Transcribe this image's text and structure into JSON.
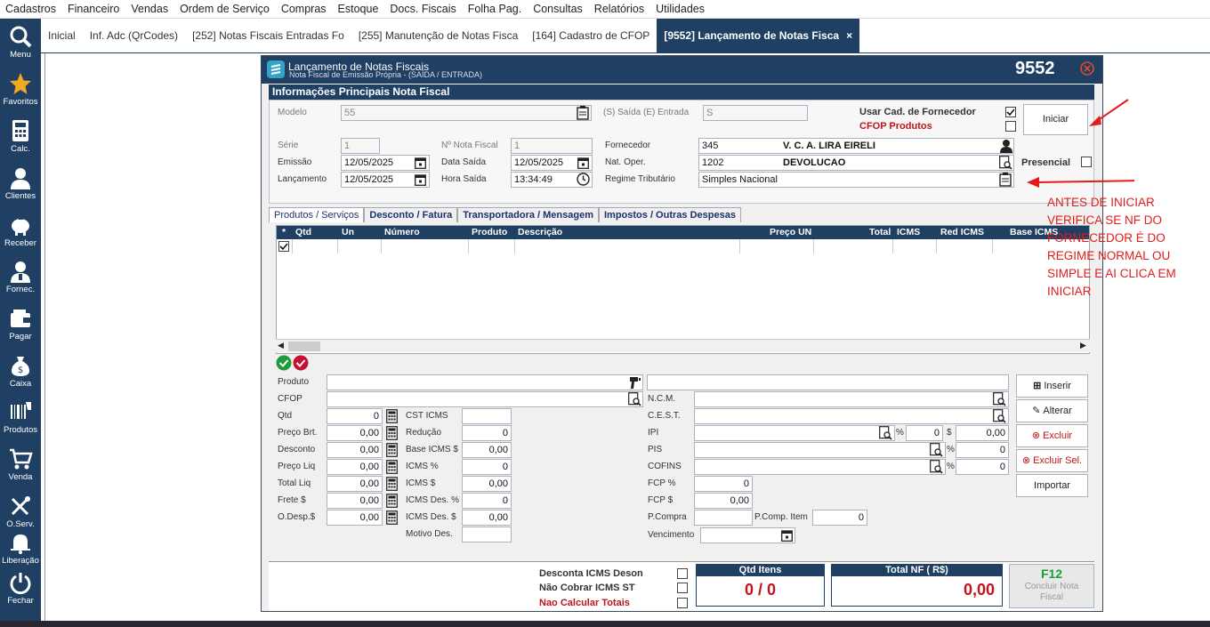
{
  "menubar": [
    "Cadastros",
    "Financeiro",
    "Vendas",
    "Ordem de Serviço",
    "Compras",
    "Estoque",
    "Docs. Fiscais",
    "Folha Pag.",
    "Consultas",
    "Relatórios",
    "Utilidades"
  ],
  "sidebar": {
    "items": [
      "Menu",
      "Favoritos",
      "Calc.",
      "Clientes",
      "Receber",
      "Fornec.",
      "Pagar",
      "Caixa",
      "Produtos",
      "Venda",
      "O.Serv.",
      "Liberação",
      "Fechar"
    ]
  },
  "tabs": {
    "items": [
      "Inicial",
      "Inf. Adc (QrCodes)",
      "[252] Notas Fiscais Entradas Fo",
      "[255] Manutenção de Notas Fisca",
      "[164] Cadastro de CFOP"
    ],
    "active": "[9552] Lançamento de Notas Fisca",
    "close": "×"
  },
  "window": {
    "title": "Lançamento de Notas Fiscais",
    "subtitle": "Nota Fiscal de Emissão Própria - (SAÍDA / ENTRADA)",
    "number": "9552"
  },
  "header": {
    "section_title": "Informações Principais Nota Fiscal",
    "modelo_label": "Modelo",
    "modelo": "55",
    "saida_entrada_label": "(S) Saída (E) Entrada",
    "saida_entrada": "S",
    "usar_cad_label": "Usar Cad. de Fornecedor",
    "cfop_produtos_label": "CFOP Produtos",
    "iniciar": "Iniciar",
    "serie_label": "Série",
    "serie": "1",
    "nota_fiscal_label": "Nº Nota Fiscal",
    "nota_fiscal": "1",
    "fornecedor_label": "Fornecedor",
    "fornecedor_code": "345",
    "fornecedor_name": "V. C. A. LIRA EIRELI",
    "presencial_label": "Presencial",
    "emissao_label": "Emissão",
    "emissao": "12/05/2025",
    "data_saida_label": "Data Saída",
    "data_saida": "12/05/2025",
    "nat_oper_label": "Nat. Oper.",
    "nat_oper_code": "1202",
    "nat_oper_name": "DEVOLUCAO",
    "lancamento_label": "Lançamento",
    "lancamento": "12/05/2025",
    "hora_saida_label": "Hora Saída",
    "hora_saida": "13:34:49",
    "regime_label": "Regime Tributário",
    "regime": "Simples Nacional"
  },
  "panel_tabs": [
    "Produtos / Serviços",
    "Desconto / Fatura",
    "Transportadora / Mensagem",
    "Impostos / Outras Despesas"
  ],
  "grid_columns": [
    "*",
    "Qtd",
    "Un",
    "Número",
    "Produto",
    "Descrição",
    "Preço UN",
    "Total",
    "ICMS",
    "Red ICMS",
    "Base ICMS"
  ],
  "item_form": {
    "produto_label": "Produto",
    "cfop_label": "CFOP",
    "qtd_label": "Qtd",
    "qtd": "0",
    "preco_brt_label": "Preço Brt.",
    "preco_brt": "0,00",
    "desconto_label": "Desconto",
    "desconto": "0,00",
    "preco_liq_label": "Preço Liq",
    "preco_liq": "0,00",
    "total_liq_label": "Total Liq",
    "total_liq": "0,00",
    "frete_label": "Frete $",
    "frete": "0,00",
    "odesp_label": "O.Desp.$",
    "odesp": "0,00",
    "cst_icms_label": "CST ICMS",
    "cst_icms": "",
    "reducao_label": "Redução",
    "reducao": "0",
    "base_icms_label": "Base ICMS $",
    "base_icms": "0,00",
    "icms_pct_label": "ICMS %",
    "icms_pct": "0",
    "icms_val_label": "ICMS $",
    "icms_val": "0,00",
    "icms_des_pct_label": "ICMS Des. %",
    "icms_des_pct": "0",
    "icms_des_val_label": "ICMS Des. $",
    "icms_des_val": "0,00",
    "motivo_des_label": "Motivo Des.",
    "ncm_label": "N.C.M.",
    "cest_label": "C.E.S.T.",
    "ipi_label": "IPI",
    "ipi_pct": "0",
    "ipi_val": "0,00",
    "pis_label": "PIS",
    "pis_pct": "0",
    "cofins_label": "COFINS",
    "cofins_pct": "0",
    "fcp_pct_label": "FCP %",
    "fcp_pct": "0",
    "fcp_val_label": "FCP $",
    "fcp_val": "0,00",
    "pcompra_label": "P.Compra",
    "pcomp_item_label": "P.Comp. Item",
    "pcomp_item": "0",
    "vencimento_label": "Vencimento",
    "pct": "%",
    "dollar": "$"
  },
  "actions": {
    "inserir": "Inserir",
    "alterar": "Alterar",
    "excluir": "Excluir",
    "excluir_sel": "Excluir Sel.",
    "importar": "Importar"
  },
  "footer": {
    "desconta_icms": "Desconta ICMS Deson",
    "nao_cobrar": "Não Cobrar ICMS ST",
    "nao_calcular": "Nao Calcular Totais",
    "qtd_itens_label": "Qtd Itens",
    "qtd_itens": "0 / 0",
    "total_nf_label": "Total NF ( R$)",
    "total_nf": "0,00",
    "f12": "F12",
    "concluir": "Concluir Nota Fiscal"
  },
  "annotation": "ANTES DE INICIAR VERIFICA SE NF DO FORNECEDOR É DO REGIME NORMAL OU SIMPLE E AI CLICA EM INICIAR",
  "colors": {
    "navy": "#1f3f63",
    "red": "#c0131a",
    "annot": "#e21c1c"
  }
}
